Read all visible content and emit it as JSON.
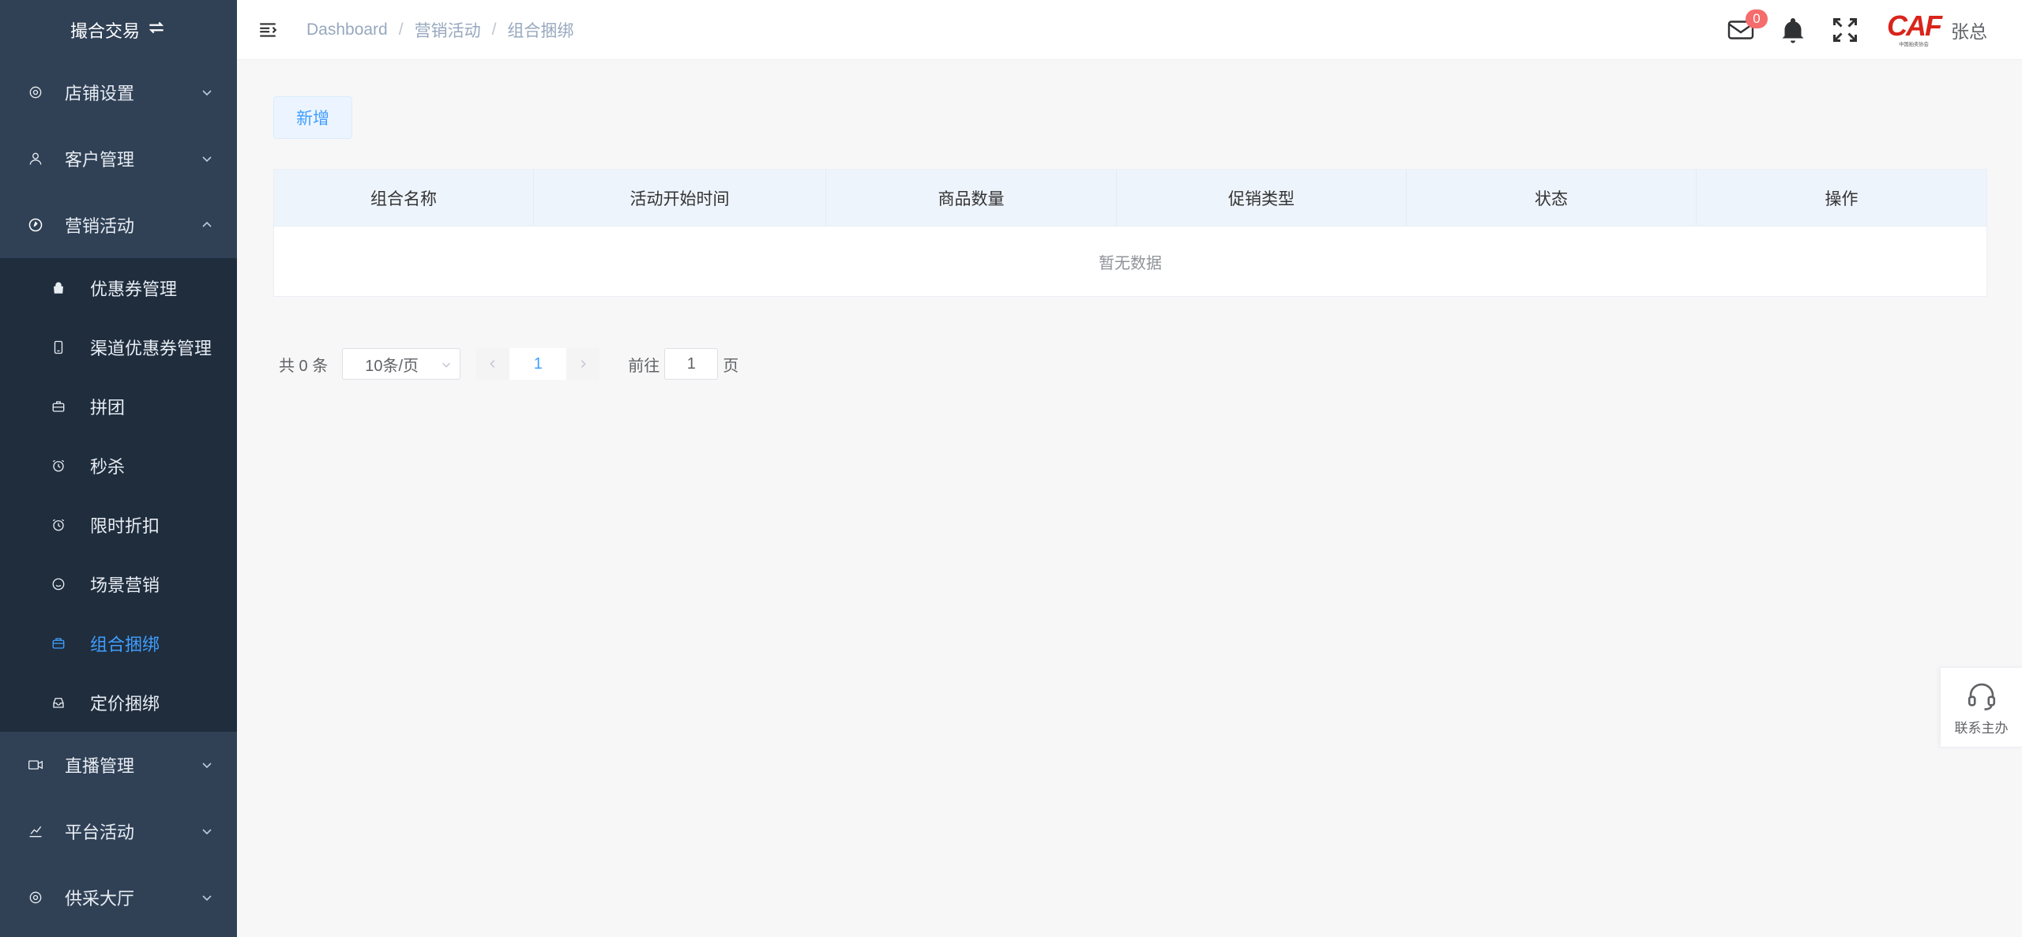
{
  "sidebar": {
    "title": "撮合交易",
    "menus": [
      {
        "label": "店铺设置",
        "icon": "gear-icon"
      },
      {
        "label": "客户管理",
        "icon": "user-icon"
      },
      {
        "label": "营销活动",
        "icon": "compass-icon"
      }
    ],
    "submenu": [
      {
        "label": "优惠券管理",
        "icon": "bag-icon"
      },
      {
        "label": "渠道优惠券管理",
        "icon": "phone-icon"
      },
      {
        "label": "拼团",
        "icon": "briefcase-icon"
      },
      {
        "label": "秒杀",
        "icon": "alarm-icon"
      },
      {
        "label": "限时折扣",
        "icon": "alarm-icon"
      },
      {
        "label": "场景营销",
        "icon": "face-icon"
      },
      {
        "label": "组合捆绑",
        "icon": "box-icon",
        "active": true
      },
      {
        "label": "定价捆绑",
        "icon": "tray-icon"
      }
    ],
    "menus_bottom": [
      {
        "label": "直播管理",
        "icon": "video-icon"
      },
      {
        "label": "平台活动",
        "icon": "chart-icon"
      },
      {
        "label": "供采大厅",
        "icon": "gear-icon"
      }
    ]
  },
  "header": {
    "breadcrumb": [
      "Dashboard",
      "营销活动",
      "组合捆绑"
    ],
    "mail_count": "0",
    "logo_text": "CAF",
    "logo_sub": "中国拍卖协会",
    "username": "张总"
  },
  "main": {
    "add_label": "新增",
    "columns": [
      "组合名称",
      "活动开始时间",
      "商品数量",
      "促销类型",
      "状态",
      "操作"
    ],
    "empty_text": "暂无数据"
  },
  "pagination": {
    "total_label": "共 0 条",
    "page_size": "10条/页",
    "current_page": "1",
    "goto_label": "前往",
    "goto_value": "1",
    "page_unit": "页"
  },
  "contact": {
    "label": "联系主办"
  },
  "colors": {
    "sidebar_bg": "#304156",
    "submenu_bg": "#1f2d3d",
    "accent": "#409eff",
    "badge": "#f56c6c",
    "logo_red": "#d9241b"
  }
}
